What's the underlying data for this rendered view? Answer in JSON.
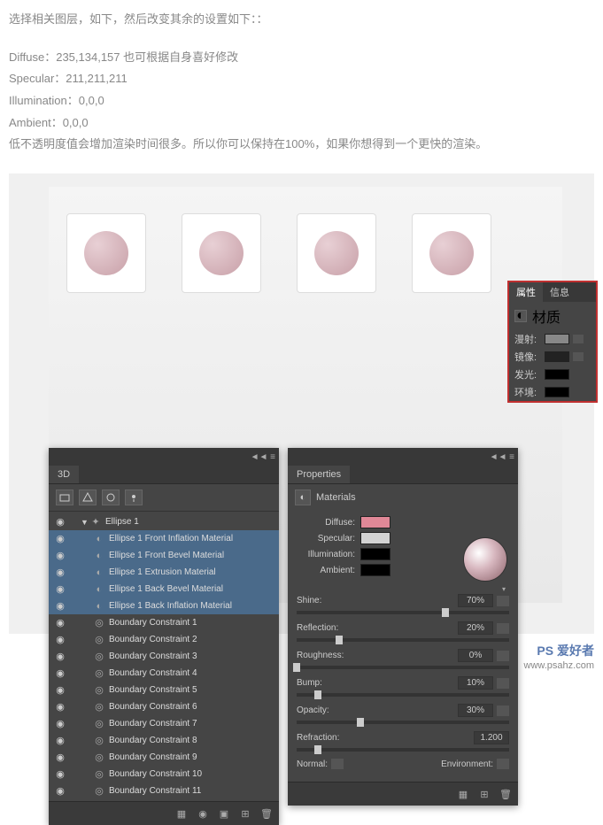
{
  "article": {
    "line1": "选择相关图层，如下，然后改变其余的设置如下：：",
    "diffuse": "Diffuse：235,134,157      也可根据自身喜好修改",
    "specular": "Specular：211,211,211",
    "illumination": "Illumination：0,0,0",
    "ambient": "Ambient：0,0,0",
    "note": "低不透明度值会增加渲染时间很多。所以你可以保持在100%，如果你想得到一个更快的渲染。"
  },
  "panel3d": {
    "tab": "3D",
    "root": "Ellipse 1",
    "selected": [
      "Ellipse 1 Front Inflation Material",
      "Ellipse 1 Front Bevel Material",
      "Ellipse 1 Extrusion Material",
      "Ellipse 1 Back Bevel Material",
      "Ellipse 1 Back Inflation Material"
    ],
    "constraints": [
      "Boundary Constraint 1",
      "Boundary Constraint 2",
      "Boundary Constraint 3",
      "Boundary Constraint 4",
      "Boundary Constraint 5",
      "Boundary Constraint 6",
      "Boundary Constraint 7",
      "Boundary Constraint 8",
      "Boundary Constraint 9",
      "Boundary Constraint 10",
      "Boundary Constraint 11"
    ]
  },
  "properties": {
    "tab": "Properties",
    "section": "Materials",
    "colors": {
      "diffuse": {
        "label": "Diffuse:",
        "hex": "#e08897"
      },
      "specular": {
        "label": "Specular:",
        "hex": "#d3d3d3"
      },
      "illumination": {
        "label": "Illumination:",
        "hex": "#000000"
      },
      "ambient": {
        "label": "Ambient:",
        "hex": "#000000"
      }
    },
    "sliders": {
      "shine": {
        "label": "Shine:",
        "value": "70%",
        "pct": 70
      },
      "reflection": {
        "label": "Reflection:",
        "value": "20%",
        "pct": 20
      },
      "roughness": {
        "label": "Roughness:",
        "value": "0%",
        "pct": 0
      },
      "bump": {
        "label": "Bump:",
        "value": "10%",
        "pct": 10
      },
      "opacity": {
        "label": "Opacity:",
        "value": "30%",
        "pct": 30
      },
      "refraction": {
        "label": "Refraction:",
        "value": "1.200",
        "pct": 10
      }
    },
    "footer": {
      "normal": "Normal:",
      "environment": "Environment:"
    }
  },
  "chinese": {
    "tab_prop": "属性",
    "tab_info": "信息",
    "title": "材质",
    "rows": {
      "diffuse": {
        "label": "漫射:",
        "hex": "#888888"
      },
      "specular": {
        "label": "镜像:",
        "hex": "#222222"
      },
      "illum": {
        "label": "发光:",
        "hex": "#000000"
      },
      "ambient": {
        "label": "环境:",
        "hex": "#000000"
      }
    }
  },
  "watermark": {
    "brand": "PS 爱好者",
    "url": "www.psahz.com"
  }
}
